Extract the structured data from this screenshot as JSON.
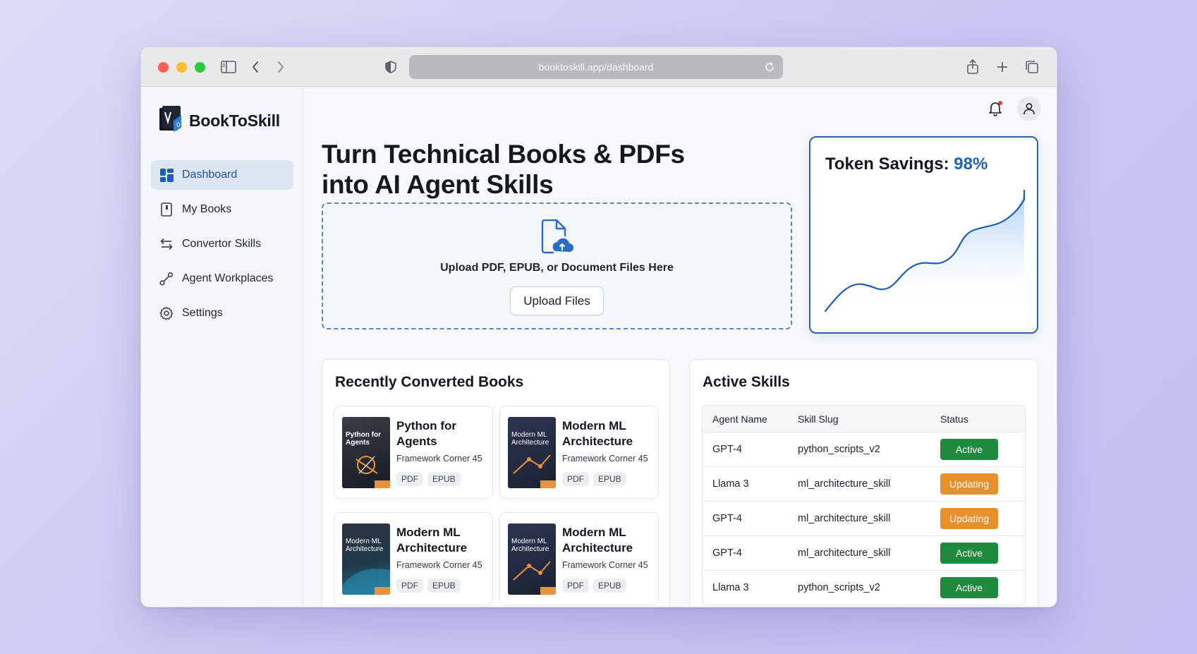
{
  "browser": {
    "url": "booktoskill.app/dashboard"
  },
  "brand": {
    "name": "BookToSkill"
  },
  "sidebar": {
    "items": [
      {
        "label": "Dashboard",
        "icon": "dashboard-grid-icon",
        "active": true
      },
      {
        "label": "My Books",
        "icon": "book-icon",
        "active": false
      },
      {
        "label": "Convertor Skills",
        "icon": "swap-arrows-icon",
        "active": false
      },
      {
        "label": "Agent Workplaces",
        "icon": "link-nodes-icon",
        "active": false
      },
      {
        "label": "Settings",
        "icon": "gear-icon",
        "active": false
      }
    ]
  },
  "hero": {
    "title_line1": "Turn Technical Books & PDFs",
    "title_line2": "into AI Agent Skills"
  },
  "upload": {
    "prompt": "Upload PDF, EPUB, or Document Files Here",
    "button_label": "Upload Files"
  },
  "savings": {
    "label": "Token Savings:",
    "value": "98%"
  },
  "books": {
    "title": "Recently Converted Books",
    "items": [
      {
        "title": "Python for Agents",
        "cover_title": "Python for Agents",
        "publisher": "Framework Corner 45",
        "formats": [
          "PDF",
          "EPUB"
        ]
      },
      {
        "title": "Modern ML Architecture",
        "cover_title": "Modern ML Architecture",
        "publisher": "Framework Corner 45",
        "formats": [
          "PDF",
          "EPUB"
        ]
      },
      {
        "title": "Modern ML Architecture",
        "cover_title": "Modern ML Architecture",
        "publisher": "Framework Corner 45",
        "formats": [
          "PDF",
          "EPUB"
        ]
      },
      {
        "title": "Modern ML Architecture",
        "cover_title": "Modern ML Architecture",
        "publisher": "Framework Corner 45",
        "formats": [
          "PDF",
          "EPUB"
        ]
      }
    ]
  },
  "skills": {
    "title": "Active Skills",
    "columns": [
      "Agent Name",
      "Skill Slug",
      "Status"
    ],
    "rows": [
      {
        "agent": "GPT-4",
        "slug": "python_scripts_v2",
        "status": "Active"
      },
      {
        "agent": "Llama 3",
        "slug": "ml_architecture_skill",
        "status": "Updating"
      },
      {
        "agent": "GPT-4",
        "slug": "ml_architecture_skill",
        "status": "Updating"
      },
      {
        "agent": "GPT-4",
        "slug": "ml_architecture_skill",
        "status": "Active"
      },
      {
        "agent": "Llama 3",
        "slug": "python_scripts_v2",
        "status": "Active"
      }
    ]
  },
  "colors": {
    "accent": "#1e62b8",
    "active": "#1f8a3b",
    "updating": "#e8902d"
  }
}
